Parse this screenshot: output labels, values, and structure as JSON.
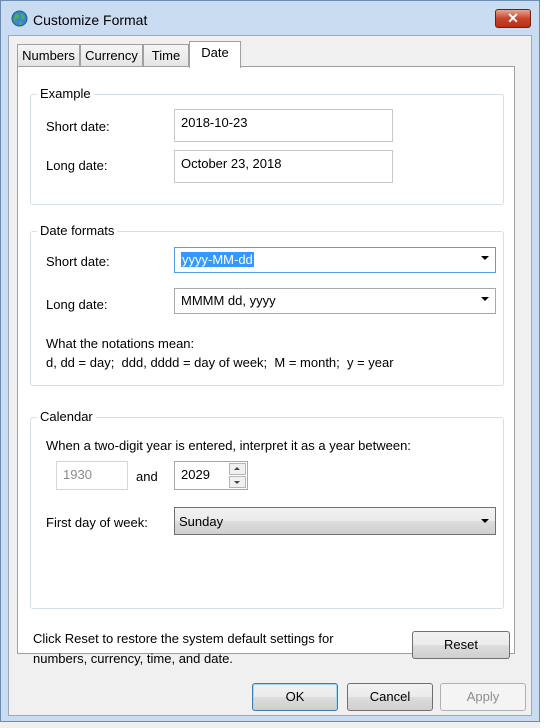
{
  "window": {
    "title": "Customize Format",
    "close_label": "✕"
  },
  "tabs": [
    {
      "label": "Numbers"
    },
    {
      "label": "Currency"
    },
    {
      "label": "Time"
    },
    {
      "label": "Date",
      "active": true
    }
  ],
  "example": {
    "group_title": "Example",
    "short_label": "Short date:",
    "short_value": "2018-10-23",
    "long_label": "Long date:",
    "long_value": "October 23, 2018"
  },
  "date_formats": {
    "group_title": "Date formats",
    "short_label": "Short date:",
    "short_value": "yyyy-MM-dd",
    "long_label": "Long date:",
    "long_value": "MMMM dd, yyyy",
    "notation_title": "What the notations mean:",
    "notation_text": "d, dd = day;  ddd, dddd = day of week;  M = month;  y = year"
  },
  "calendar": {
    "group_title": "Calendar",
    "two_digit_text": "When a two-digit year is entered, interpret it as a year between:",
    "year_start": "1930",
    "and_label": "and",
    "year_end": "2029",
    "first_day_label": "First day of week:",
    "first_day_value": "Sunday"
  },
  "footer": {
    "reset_text": "Click Reset to restore the system default settings for numbers, currency, time, and date.",
    "reset_label": "Reset"
  },
  "buttons": {
    "ok": "OK",
    "cancel": "Cancel",
    "apply": "Apply"
  }
}
